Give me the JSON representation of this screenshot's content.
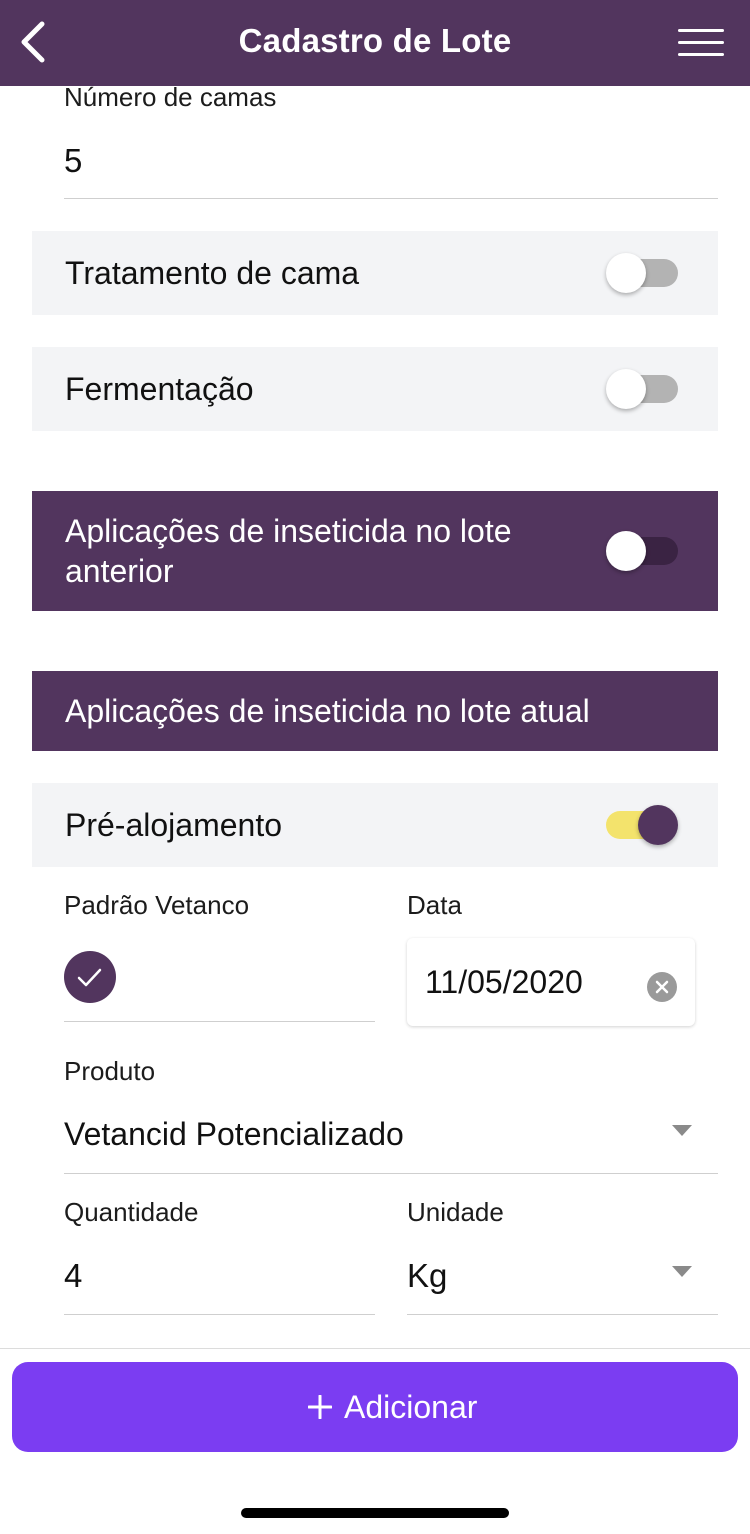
{
  "header": {
    "title": "Cadastro de Lote",
    "back_icon": "chevron-left-icon",
    "menu_icon": "hamburger-menu-icon",
    "background_color": "#52355e"
  },
  "form": {
    "numero_camas": {
      "label": "Número de camas",
      "value": "5"
    },
    "tratamento_cama": {
      "label": "Tratamento de cama",
      "enabled": false
    },
    "fermentacao": {
      "label": "Fermentação",
      "enabled": false
    },
    "inseticida_lote_anterior": {
      "label_line1": "Aplicações de inseticida no lote",
      "label_line2": "anterior",
      "enabled": false
    },
    "inseticida_lote_atual": {
      "label": "Aplicações de inseticida no lote atual"
    },
    "pre_alojamento": {
      "label": "Pré-alojamento",
      "enabled": true
    },
    "padrao_vetanco": {
      "label": "Padrão Vetanco",
      "checked": true,
      "check_icon": "checkmark-icon"
    },
    "data": {
      "label": "Data",
      "value": "11/05/2020",
      "clear_icon": "clear-circle-icon"
    },
    "produto": {
      "label": "Produto",
      "value": "Vetancid Potencializado",
      "dropdown_icon": "caret-down-icon"
    },
    "quantidade": {
      "label": "Quantidade",
      "value": "4"
    },
    "unidade": {
      "label": "Unidade",
      "value": "Kg",
      "dropdown_icon": "caret-down-icon"
    }
  },
  "footer": {
    "add_button_label": "Adicionar",
    "add_icon": "plus-icon",
    "button_color": "#7b3df2"
  },
  "colors": {
    "primary": "#52355e",
    "toggle_on_track": "#f3e36c",
    "toggle_off_track": "#b3b3b3",
    "row_background": "#f3f4f6"
  }
}
